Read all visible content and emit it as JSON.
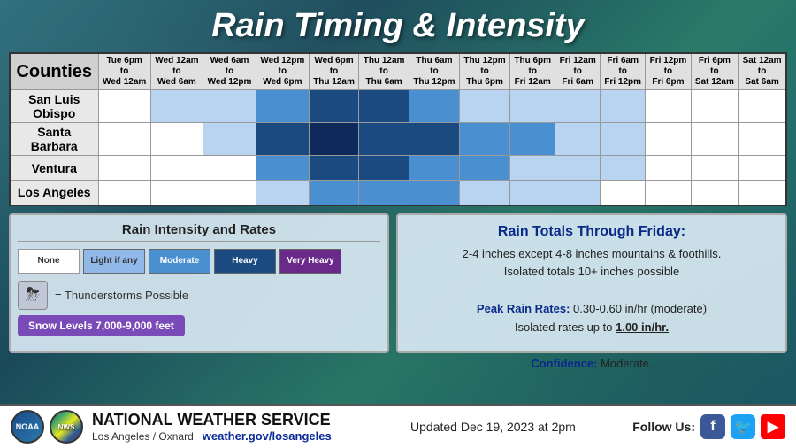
{
  "title": "Rain Timing & Intensity",
  "table": {
    "counties_header": "Counties",
    "time_columns": [
      {
        "line1": "Tue 6pm",
        "line2": "to",
        "line3": "Wed 12am"
      },
      {
        "line1": "Wed 12am",
        "line2": "to",
        "line3": "Wed 6am"
      },
      {
        "line1": "Wed 6am",
        "line2": "to",
        "line3": "Wed 12pm"
      },
      {
        "line1": "Wed 12pm",
        "line2": "to",
        "line3": "Wed 6pm"
      },
      {
        "line1": "Wed 6pm",
        "line2": "to",
        "line3": "Thu 12am"
      },
      {
        "line1": "Thu 12am",
        "line2": "to",
        "line3": "Thu 6am"
      },
      {
        "line1": "Thu 6am",
        "line2": "to",
        "line3": "Thu 12pm"
      },
      {
        "line1": "Thu 12pm",
        "line2": "to",
        "line3": "Thu 6pm"
      },
      {
        "line1": "Thu 6pm",
        "line2": "to",
        "line3": "Fri 12am"
      },
      {
        "line1": "Fri 12am",
        "line2": "to",
        "line3": "Fri 6am"
      },
      {
        "line1": "Fri 6am",
        "line2": "to",
        "line3": "Fri 12pm"
      },
      {
        "line1": "Fri 12pm",
        "line2": "to",
        "line3": "Fri 6pm"
      },
      {
        "line1": "Fri 6pm",
        "line2": "to",
        "line3": "Sat 12am"
      },
      {
        "line1": "Sat 12am",
        "line2": "to",
        "line3": "Sat 6am"
      }
    ],
    "counties": [
      {
        "name": "San Luis Obispo",
        "cells": [
          "c-none",
          "c-light",
          "c-light",
          "c-moderate",
          "c-dark",
          "c-dark",
          "c-moderate",
          "c-light",
          "c-light",
          "c-light",
          "c-light",
          "c-none",
          "c-none",
          "c-none"
        ]
      },
      {
        "name": "Santa Barbara",
        "cells": [
          "c-none",
          "c-none",
          "c-light",
          "c-dark",
          "c-very-dark",
          "c-dark",
          "c-dark",
          "c-moderate",
          "c-moderate",
          "c-light",
          "c-light",
          "c-none",
          "c-none",
          "c-none"
        ]
      },
      {
        "name": "Ventura",
        "cells": [
          "c-none",
          "c-none",
          "c-none",
          "c-moderate",
          "c-dark",
          "c-dark",
          "c-moderate",
          "c-moderate",
          "c-light",
          "c-light",
          "c-light",
          "c-none",
          "c-none",
          "c-none"
        ]
      },
      {
        "name": "Los Angeles",
        "cells": [
          "c-none",
          "c-none",
          "c-none",
          "c-light",
          "c-moderate",
          "c-moderate",
          "c-moderate",
          "c-light",
          "c-light",
          "c-light",
          "c-none",
          "c-none",
          "c-none",
          "c-none"
        ]
      }
    ]
  },
  "legend": {
    "title": "Rain Intensity and Rates",
    "items": [
      {
        "label": "None",
        "class": "none"
      },
      {
        "label": "Light if any",
        "class": "light"
      },
      {
        "label": "Moderate",
        "class": "moderate"
      },
      {
        "label": "Heavy",
        "class": "heavy"
      },
      {
        "label": "Very Heavy",
        "class": "very-heavy"
      }
    ],
    "thunder_icon": "⛈",
    "thunder_text": "= Thunderstorms Possible",
    "snow_text": "Snow Levels 7,000-9,000 feet"
  },
  "totals": {
    "title": "Rain Totals Through Friday:",
    "line1": "2-4 inches except 4-8 inches mountains & foothills.",
    "line2": "Isolated totals 10+ inches possible",
    "peak_label": "Peak Rain Rates:",
    "peak_value": "0.30-0.60 in/hr (moderate)",
    "isolated_label": "Isolated rates up to",
    "isolated_value": "1.00 in/hr.",
    "confidence_label": "Confidence:",
    "confidence_value": "Moderate."
  },
  "footer": {
    "logo_noaa": "NOAA",
    "logo_nws": "NWS",
    "org_name": "NATIONAL WEATHER SERVICE",
    "org_sub": "Los Angeles / Oxnard",
    "org_url": "weather.gov/losangeles",
    "updated": "Updated Dec 19, 2023 at 2pm",
    "follow_label": "Follow Us:"
  }
}
